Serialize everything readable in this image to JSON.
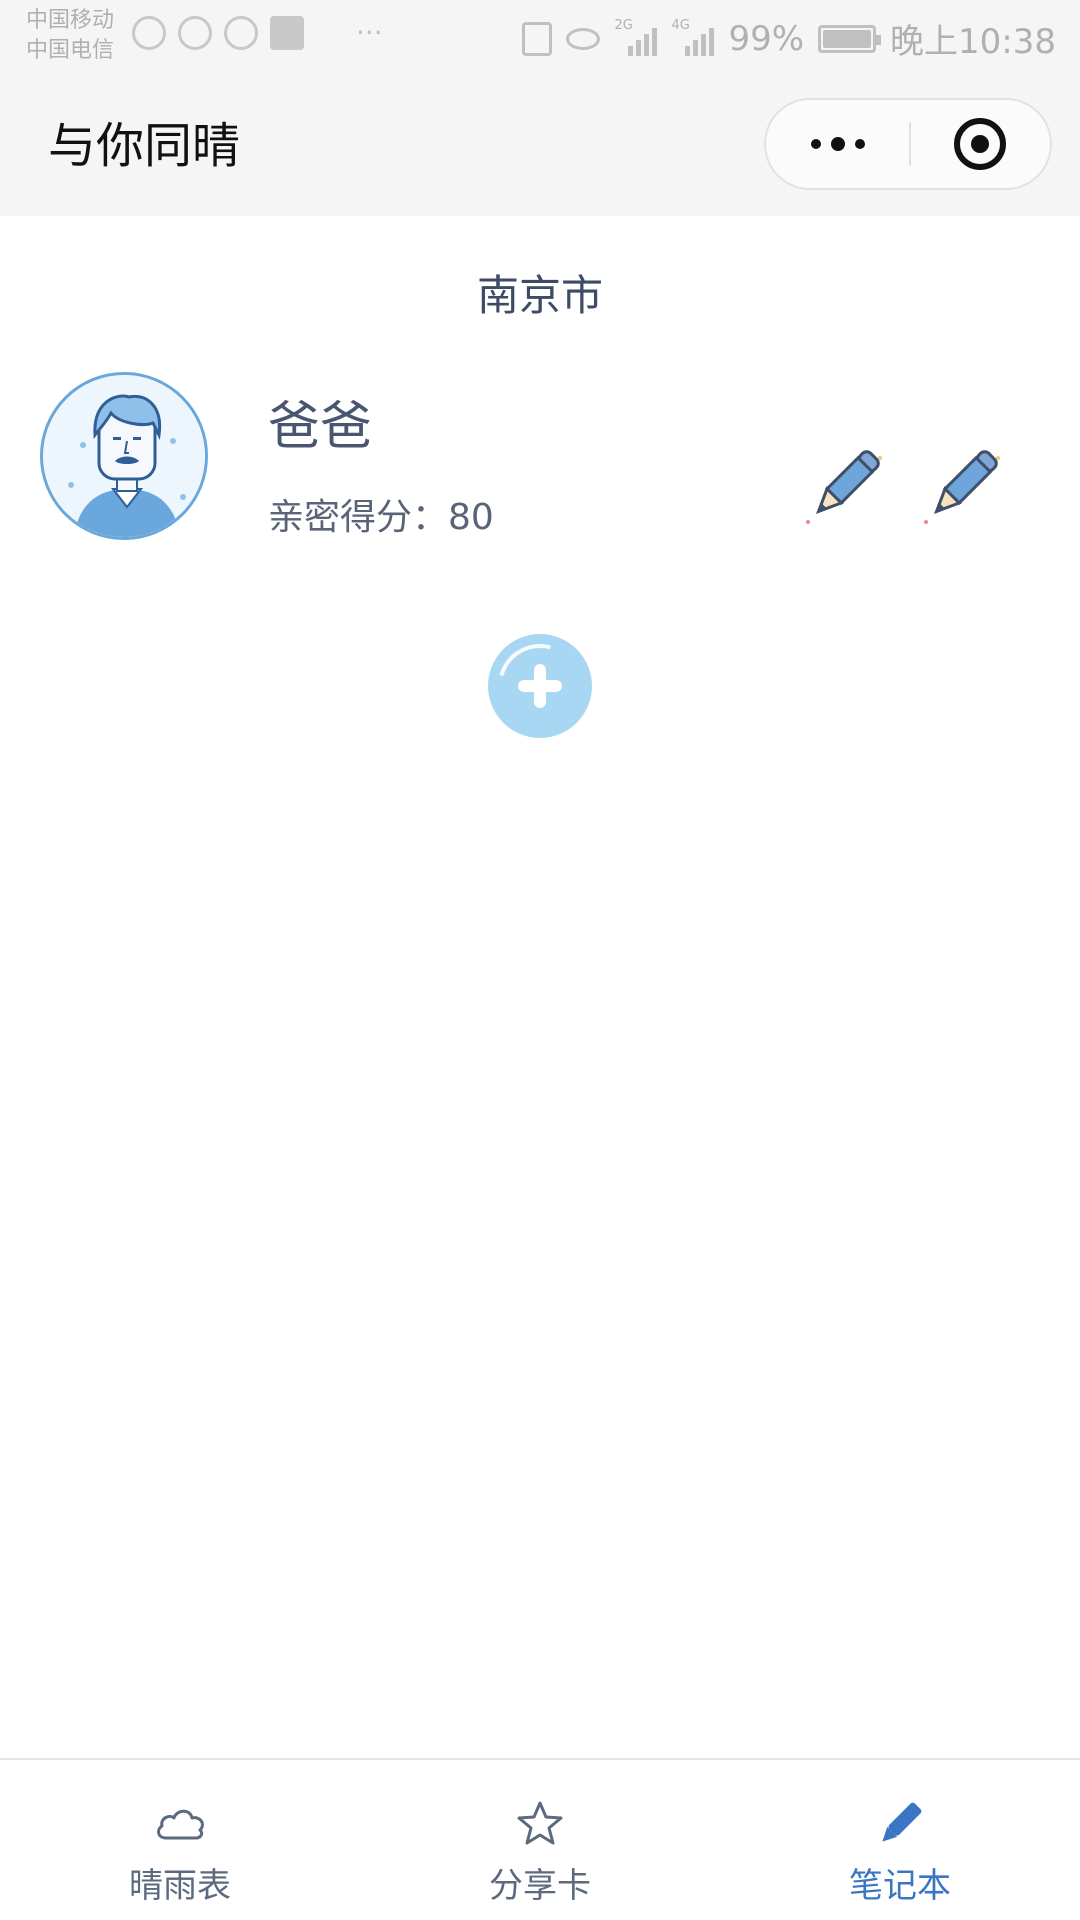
{
  "status_bar": {
    "carrier_1": "中国移动",
    "carrier_2": "中国电信",
    "dots": "···",
    "battery_level": 0.99,
    "battery_text": "99%",
    "time": "晚上10:38",
    "net_2g": "2G",
    "net_4g": "4G"
  },
  "nav": {
    "title": "与你同晴"
  },
  "main": {
    "city": "南京市",
    "people": [
      {
        "name": "爸爸",
        "score_label": "亲密得分：",
        "score_value": "80"
      }
    ]
  },
  "tab_bar": {
    "tabs": [
      {
        "label": "晴雨表",
        "icon": "cloud-icon",
        "active": false
      },
      {
        "label": "分享卡",
        "icon": "star-icon",
        "active": false
      },
      {
        "label": "笔记本",
        "icon": "pencil-icon",
        "active": true
      }
    ]
  },
  "colors": {
    "active_tab": "#3a76c4",
    "inactive_tab": "#5c6a7e",
    "add_button": "#a8d7f3",
    "pencil_blue": "#6ea6db"
  }
}
